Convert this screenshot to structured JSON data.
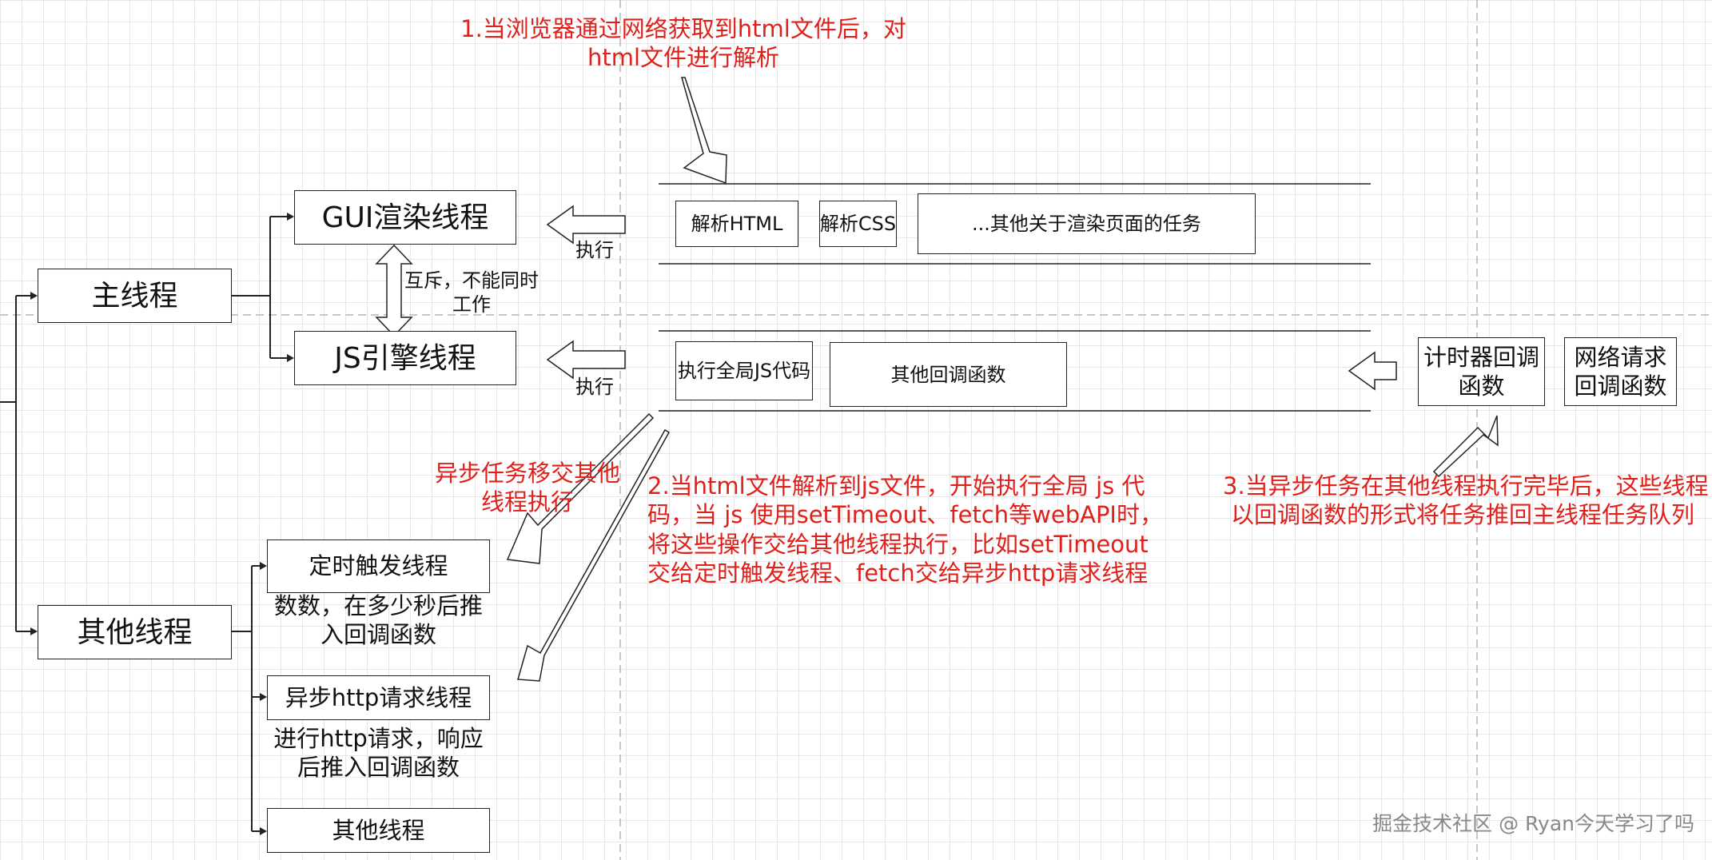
{
  "threads": {
    "main": "主线程",
    "gui": "GUI渲染线程",
    "js": "JS引擎线程",
    "other": "其他线程",
    "timer": "定时触发线程",
    "http": "异步http请求线程",
    "other_sub": "其他线程"
  },
  "labels": {
    "mutex": [
      "互斥，不能同时",
      "工作"
    ],
    "exec_gui": "执行",
    "exec_js": "执行",
    "timer_desc": [
      "数数，在多少秒后推",
      "入回调函数"
    ],
    "http_desc": [
      "进行http请求，响应",
      "后推入回调函数"
    ],
    "async_transfer": [
      "异步任务移交其他",
      "线程执行"
    ]
  },
  "gui_tasks": [
    "解析HTML",
    "解析CSS",
    "...其他关于渲染页面的任务"
  ],
  "js_tasks": [
    "执行全局JS代码",
    "其他回调函数"
  ],
  "callbacks": {
    "timer": [
      "计时器回调",
      "函数"
    ],
    "network": [
      "网络请求",
      "回调函数"
    ]
  },
  "notes": {
    "step1": [
      "1.当浏览器通过网络获取到html文件后，对",
      "html文件进行解析"
    ],
    "step2": [
      "2.当html文件解析到js文件，开始执行全局 js 代",
      "码，当 js 使用setTimeout、fetch等webAPI时，",
      "将这些操作交给其他线程执行，比如setTimeout",
      "交给定时触发线程、fetch交给异步http请求线程"
    ],
    "step3": [
      "3.当异步任务在其他线程执行完毕后，这些线程",
      "以回调函数的形式将任务推回主线程任务队列"
    ]
  },
  "watermark": "掘金技术社区 @ Ryan今天学习了吗",
  "colors": {
    "note": "#e0201b",
    "line": "#222222",
    "grid": "#e6e6e6"
  }
}
